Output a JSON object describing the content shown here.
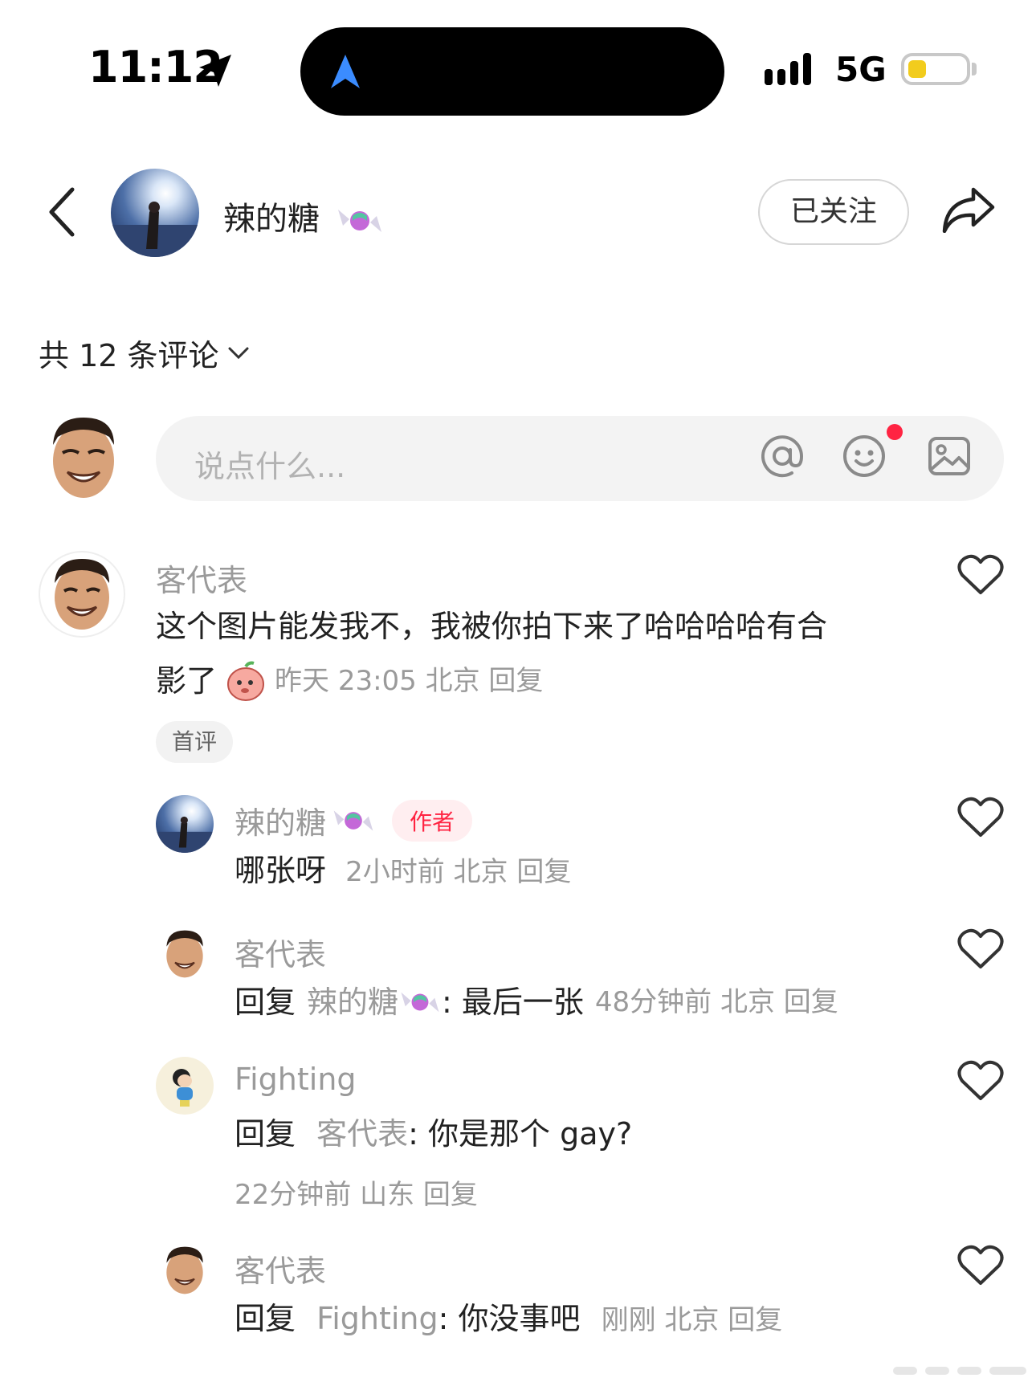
{
  "status": {
    "time": "11:12",
    "network": "5G",
    "battery_color": "#f2cc1d"
  },
  "header": {
    "username": "辣的糖",
    "follow_label": "已关注"
  },
  "comments_count_label": "共 12 条评论",
  "input": {
    "placeholder": "说点什么..."
  },
  "comments": [
    {
      "name": "客代表",
      "text_line1": "这个图片能发我不，我被你拍下来了哈哈哈哈有合",
      "text_line2": "影了",
      "meta": "昨天 23:05 北京 回复",
      "badge": "首评"
    }
  ],
  "replies": [
    {
      "name": "辣的糖",
      "tag": "作者",
      "text": "哪张呀",
      "meta": "2小时前 北京 回复"
    },
    {
      "name": "客代表",
      "reply_label": "回复",
      "reply_target": "辣的糖",
      "text": ": 最后一张",
      "meta": "48分钟前 北京 回复"
    },
    {
      "name": "Fighting",
      "reply_label": "回复",
      "reply_target": "客代表",
      "text": ": 你是那个 gay?",
      "meta": "22分钟前 山东 回复"
    },
    {
      "name": "客代表",
      "reply_label": "回复",
      "reply_target": "Fighting",
      "text": ": 你没事吧",
      "meta": "刚刚 北京 回复"
    }
  ],
  "colors": {
    "accent_red": "#ff2442",
    "muted_text": "#9a9a9a"
  }
}
